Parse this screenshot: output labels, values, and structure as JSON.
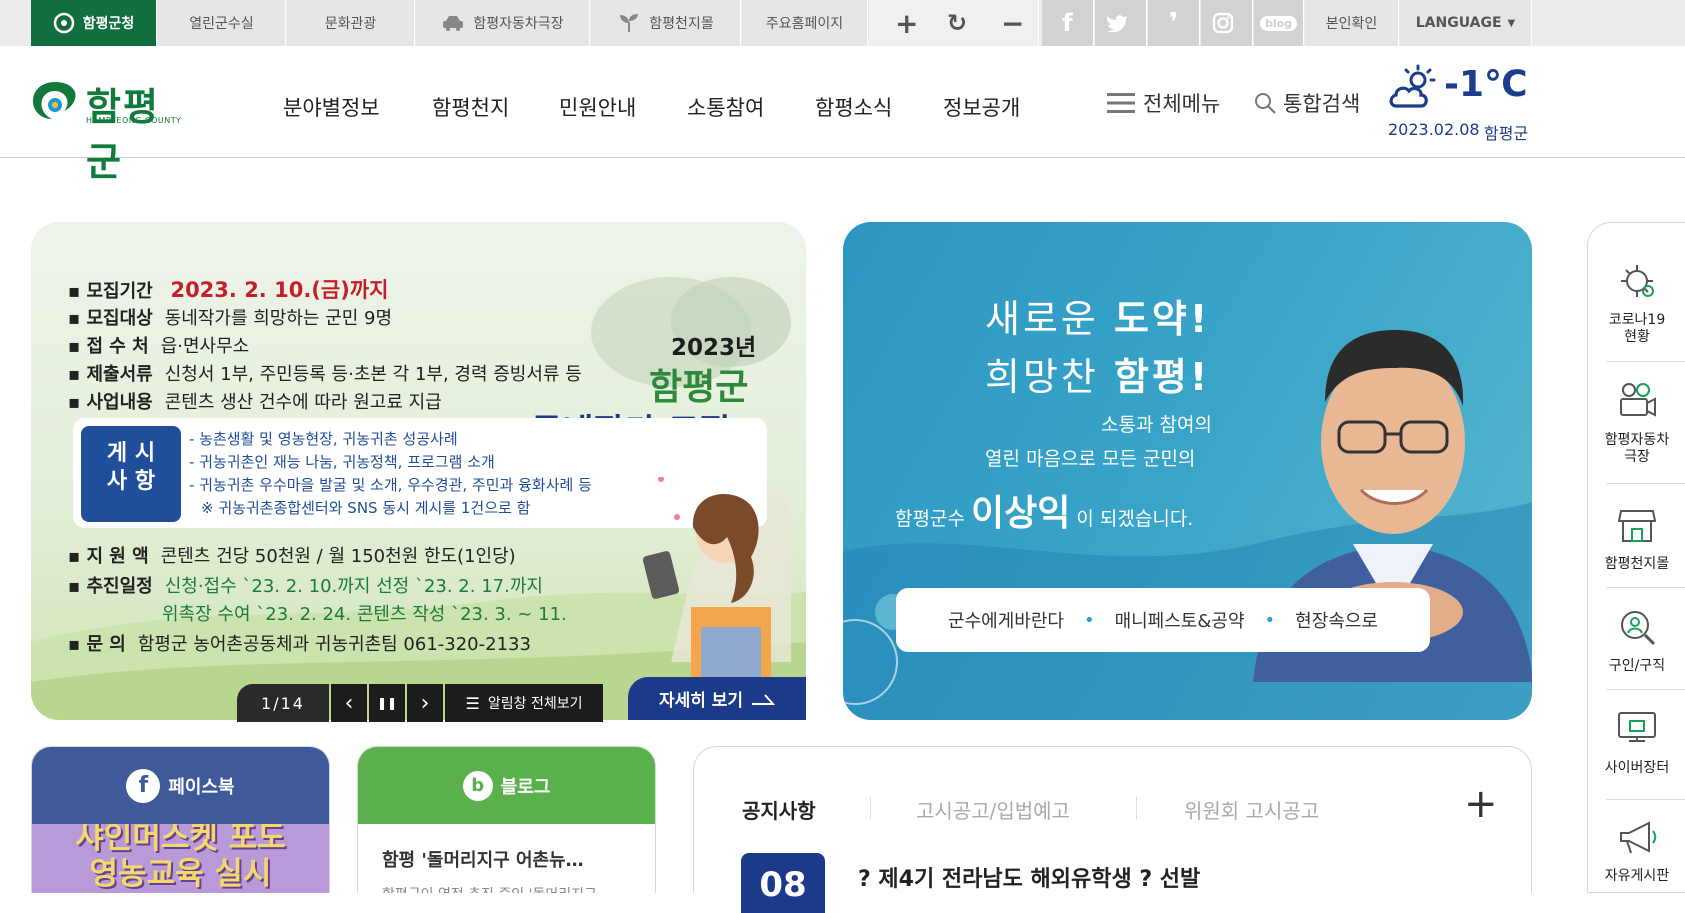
{
  "topbar": {
    "items": [
      {
        "label": "함평군청",
        "active": true
      },
      {
        "label": "열린군수실"
      },
      {
        "label": "문화관광"
      },
      {
        "label": "함평자동차극장",
        "icon": "car-icon"
      },
      {
        "label": "함평천지몰",
        "icon": "sprout-icon"
      },
      {
        "label": "주요홈페이지"
      }
    ],
    "zoom_in": "+",
    "zoom_reset": "↻",
    "zoom_out": "−",
    "sns": [
      "facebook-icon",
      "twitter-icon",
      "kakaostory-icon",
      "instagram-icon",
      "blog-icon"
    ],
    "blog_text": "blog",
    "verify": "본인확인",
    "language": "LANGUAGE"
  },
  "header": {
    "logo_name": "함평군",
    "logo_sub": "HAMPYEONG COUNTY",
    "nav": [
      "분야별정보",
      "함평천지",
      "민원안내",
      "소통참여",
      "함평소식",
      "정보공개"
    ],
    "all_menu": "전체메뉴",
    "search": "통합검색",
    "weather": {
      "temp": "-1℃",
      "date": "2023.02.08",
      "location": "함평군",
      "icon": "partly-cloudy-icon"
    }
  },
  "main_banner": {
    "rows": [
      {
        "key": "▪ 모집기간",
        "value": "2023. 2. 10.(금)까지"
      },
      {
        "key": "▪ 모집대상",
        "value": "동네작가를 희망하는 군민 9명"
      },
      {
        "key": "▪ 접 수 처",
        "value": "읍·면사무소"
      },
      {
        "key": "▪ 제출서류",
        "value": "신청서 1부, 주민등록 등·초본 각 1부, 경력 증빙서류 등"
      },
      {
        "key": "▪ 사업내용",
        "value": "콘텐츠 생산 건수에 따라 원고료 지급"
      }
    ],
    "notice_tag": "게 시\n사 항",
    "notice_lines": [
      "- 농촌생활 및 영농현장, 귀농귀촌 성공사례",
      "- 귀농귀촌인 재능 나눔, 귀농정책, 프로그램 소개",
      "- 귀농귀촌 우수마을 발굴 및 소개, 우수경관, 주민과 융화사례 등",
      "※ 귀농귀촌종합센터와 SNS 동시 게시를 1건으로 함"
    ],
    "rows2": [
      {
        "key": "▪ 지 원 액",
        "value": "콘텐츠 건당 50천원 / 월 150천원 한도(1인당)"
      },
      {
        "key": "▪ 추진일정",
        "value": "신청·접수 `23. 2. 10.까지 선정 `23. 2. 17.까지"
      },
      {
        "key": "",
        "value": "위촉장 수여 `23. 2. 24. 콘텐츠 작성 `23. 3. ~ 11."
      },
      {
        "key": "▪ 문      의",
        "value": "함평군 농어촌공동체과 귀농귀촌팀 061-320-2133"
      }
    ],
    "year": "2023년",
    "title1": "함평군",
    "title2": "동네작가 모집",
    "counter": "1/14",
    "prev": "‹",
    "pause": "❚❚",
    "next": "›",
    "view_all": "알림창 전체보기",
    "detail": "자세히 보기"
  },
  "mayor_banner": {
    "line1a": "새로운 ",
    "line1b": "도약!",
    "line2a": "희망찬 ",
    "line2b": "함평!",
    "line3": "소통과 참여의",
    "line4": "열린 마음으로  모든 군민의",
    "line5a": "함평군수 ",
    "line5b": "이상익",
    "line5c": " 이 되겠습니다.",
    "links": [
      "군수에게바란다",
      "매니페스토&공약",
      "현장속으로"
    ]
  },
  "quick_menu": [
    {
      "label": "코로나19\n현황",
      "icon": "virus-icon"
    },
    {
      "label": "함평자동차\n극장",
      "icon": "projector-icon"
    },
    {
      "label": "함평천지몰",
      "icon": "store-icon"
    },
    {
      "label": "구인/구직",
      "icon": "magnifier-person-icon"
    },
    {
      "label": "사이버장터",
      "icon": "cyber-market-icon"
    },
    {
      "label": "자유게시판",
      "icon": "megaphone-icon"
    }
  ],
  "sns_cards": {
    "facebook": {
      "label": "페이스북",
      "image_text": "샤인머스켓 포도\n영농교육 실시"
    },
    "blog": {
      "label": "블로그",
      "title": "함평 '돌머리지구 어촌뉴…",
      "excerpt": "함평군이 역점 추진 중인 '돌머리지구"
    }
  },
  "notice": {
    "tabs": [
      "공지사항",
      "고시공고/입법예고",
      "위원회 고시공고"
    ],
    "more": "+",
    "day": "08",
    "first_title": "? 제4기 전라남도 해외유학생 ? 선발"
  },
  "colors": {
    "brand_green": "#106e3f",
    "navy": "#1b3b8a",
    "sky": "#2c96c2"
  }
}
